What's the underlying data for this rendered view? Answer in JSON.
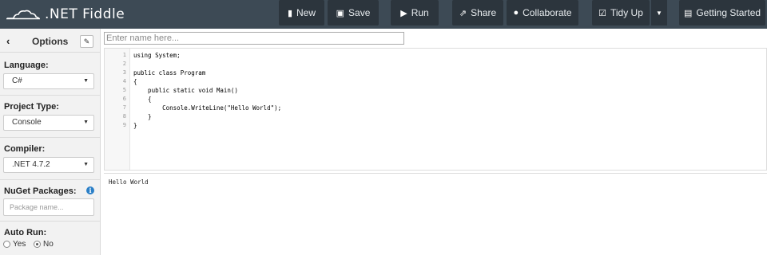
{
  "header": {
    "logo": ".NET Fiddle",
    "buttons": {
      "new": "New",
      "save": "Save",
      "run": "Run",
      "share": "Share",
      "collaborate": "Collaborate",
      "tidy_up": "Tidy Up",
      "getting_started": "Getting Started"
    },
    "icons": {
      "new": "file-icon",
      "save": "floppy-icon",
      "run": "play-icon",
      "share": "share-icon",
      "collaborate": "user-icon",
      "tidy_up": "checkbox-icon",
      "getting_started": "book-icon"
    }
  },
  "sidebar": {
    "title": "Options",
    "language_label": "Language:",
    "language_value": "C#",
    "project_type_label": "Project Type:",
    "project_type_value": "Console",
    "compiler_label": "Compiler:",
    "compiler_value": ".NET 4.7.2",
    "nuget_label": "NuGet Packages:",
    "nuget_placeholder": "Package name...",
    "auto_run_label": "Auto Run:",
    "auto_run_options": [
      "Yes",
      "No"
    ],
    "auto_run_selected": "No"
  },
  "editor": {
    "name_placeholder": "Enter name here...",
    "line_numbers": [
      "1",
      "2",
      "3",
      "4",
      "5",
      "6",
      "7",
      "8",
      "9"
    ],
    "lines": [
      "using System;",
      "",
      "public class Program",
      "{",
      "    public static void Main()",
      "    {",
      "        Console.WriteLine(\"Hello World\");",
      "    }",
      "}"
    ]
  },
  "output": {
    "text": "Hello World"
  },
  "colors": {
    "topbar": "#3d4a55",
    "button": "#2c353d",
    "sidebar": "#f2f2f2"
  }
}
